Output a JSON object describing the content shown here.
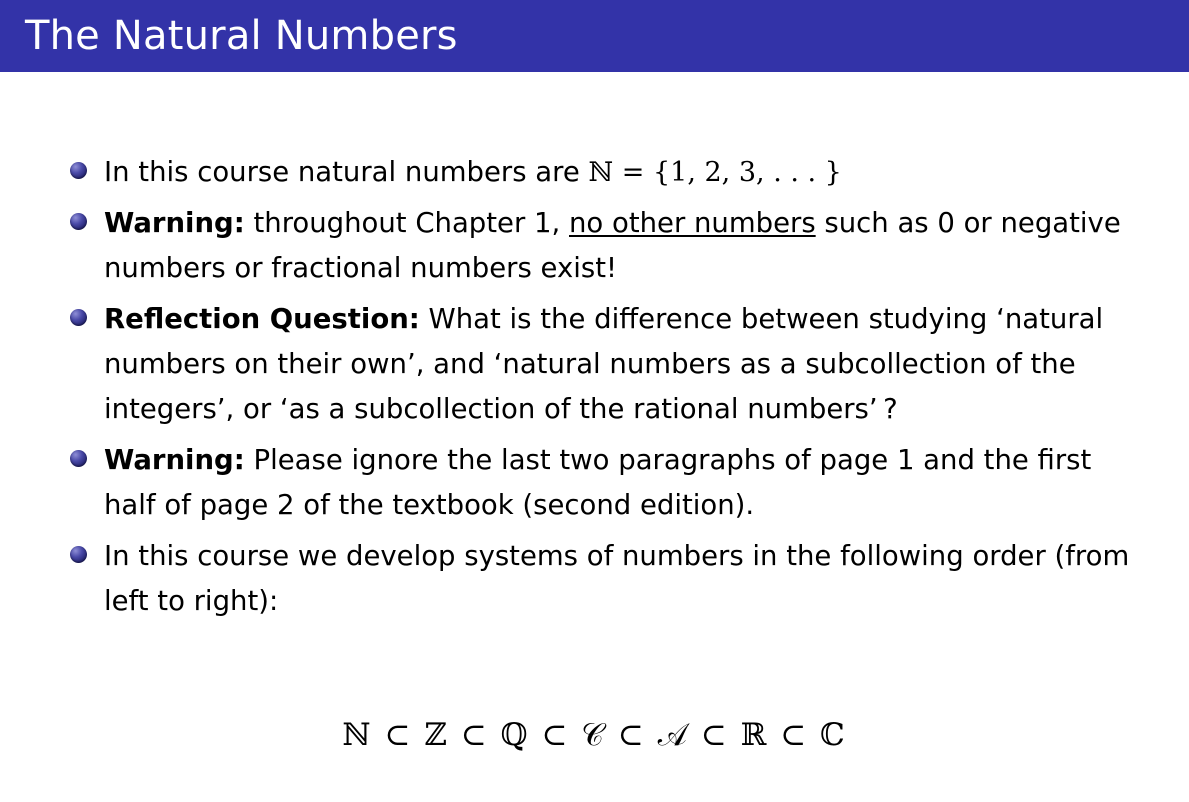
{
  "slide": {
    "title": "The Natural Numbers",
    "title_bar_color": "#3333a8",
    "title_text_color": "#ffffff",
    "background_color": "#ffffff",
    "bullet_color": "#262673",
    "text_color": "#000000"
  },
  "bullets": [
    {
      "id": "bullet-natural-numbers-definition",
      "lead": "",
      "text_before": "In this course natural numbers are ",
      "math": "ℕ = {1, 2, 3, . . . }",
      "text_after": ""
    },
    {
      "id": "bullet-warning-no-other-numbers",
      "lead": "Warning:",
      "text_before": " throughout Chapter 1, ",
      "underlined": "no other numbers",
      "text_after": " such as 0 or negative numbers or fractional numbers exist!"
    },
    {
      "id": "bullet-reflection-question",
      "lead": "Reflection Question:",
      "text_before": " What is the difference between studying ‘natural numbers on their own’, and ‘natural numbers as a subcollection of the integers’, or ‘as a subcollection of the rational numbers’ ?",
      "text_after": ""
    },
    {
      "id": "bullet-warning-ignore-paragraphs",
      "lead": "Warning:",
      "text_before": " Please ignore the last two paragraphs of page 1 and the first half of page 2 of the textbook (second edition).",
      "text_after": ""
    },
    {
      "id": "bullet-systems-order",
      "lead": "",
      "text_before": "In this course we develop systems of numbers in the following order (from left to right):",
      "text_after": ""
    }
  ],
  "formula": {
    "tokens": [
      {
        "symbol": "ℕ",
        "style": "blackboard"
      },
      {
        "symbol": "⊂",
        "style": "operator"
      },
      {
        "symbol": "ℤ",
        "style": "blackboard"
      },
      {
        "symbol": "⊂",
        "style": "operator"
      },
      {
        "symbol": "ℚ",
        "style": "blackboard"
      },
      {
        "symbol": "⊂",
        "style": "operator"
      },
      {
        "symbol": "𝒞",
        "style": "calligraphic"
      },
      {
        "symbol": "⊂",
        "style": "operator"
      },
      {
        "symbol": "𝒜",
        "style": "calligraphic"
      },
      {
        "symbol": "⊂",
        "style": "operator"
      },
      {
        "symbol": "ℝ",
        "style": "blackboard"
      },
      {
        "symbol": "⊂",
        "style": "operator"
      },
      {
        "symbol": "ℂ",
        "style": "blackboard"
      }
    ],
    "plain": "ℕ ⊂ ℤ ⊂ ℚ ⊂ 𝒞 ⊂ 𝒜 ⊂ ℝ ⊂ ℂ"
  }
}
